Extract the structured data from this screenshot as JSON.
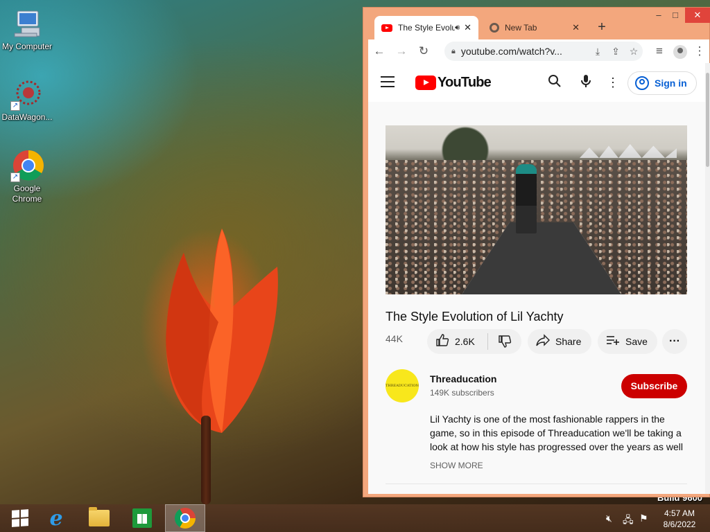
{
  "desktop": {
    "icons": [
      {
        "label": "My Computer",
        "icon": "computer-icon"
      },
      {
        "label": "DataWagon...",
        "icon": "datawagon-icon"
      },
      {
        "label": "Google Chrome",
        "icon": "chrome-icon"
      }
    ],
    "build_text": "Build 9600"
  },
  "browser": {
    "tabs": [
      {
        "title": "The Style Evolution of Lil Yachty",
        "icon": "youtube-icon",
        "active": true,
        "audio": true
      },
      {
        "title": "New Tab",
        "icon": "chrome-icon",
        "active": false
      }
    ],
    "url": "youtube.com/watch?v...",
    "window_controls": {
      "minimize": "–",
      "maximize": "□",
      "close": "✕"
    }
  },
  "youtube": {
    "logo_text": "YouTube",
    "sign_in_label": "Sign in",
    "video": {
      "title": "The Style Evolution of Lil Yachty",
      "views": "44K",
      "likes": "2.6K",
      "share_label": "Share",
      "save_label": "Save"
    },
    "channel": {
      "name": "Threaducation",
      "subscribers": "149K subscribers",
      "avatar_text": "THREADUCATION",
      "subscribe_label": "Subscribe"
    },
    "description": "Lil Yachty is one of the most fashionable rappers in the game, so in this episode of Threaducation we'll be taking a look at how his style has progressed over the years as well",
    "show_more_label": "SHOW MORE"
  },
  "taskbar": {
    "apps": [
      "start-button",
      "internet-explorer",
      "file-explorer",
      "store",
      "google-chrome"
    ],
    "clock": {
      "time": "4:57 AM",
      "date": "8/6/2022"
    }
  },
  "colors": {
    "window_frame": "#f3a77d",
    "youtube_red": "#ff0000",
    "subscribe_red": "#cc0000",
    "link_blue": "#065fd4"
  }
}
